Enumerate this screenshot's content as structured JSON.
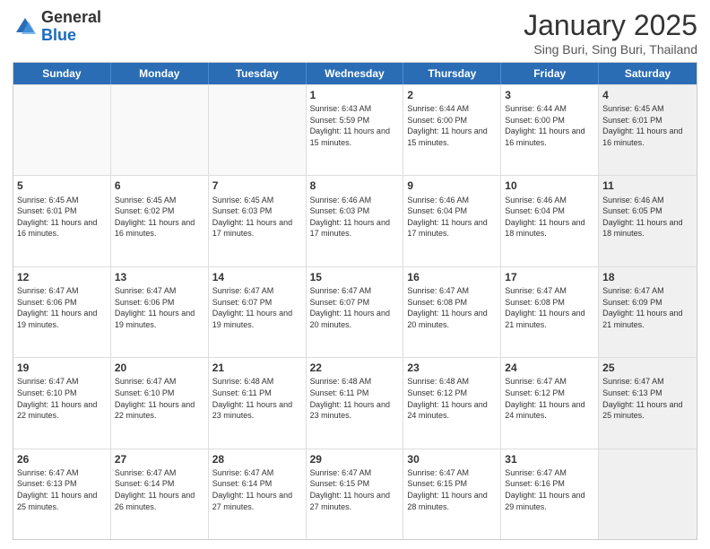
{
  "logo": {
    "general": "General",
    "blue": "Blue"
  },
  "header": {
    "title": "January 2025",
    "subtitle": "Sing Buri, Sing Buri, Thailand"
  },
  "days": [
    "Sunday",
    "Monday",
    "Tuesday",
    "Wednesday",
    "Thursday",
    "Friday",
    "Saturday"
  ],
  "rows": [
    [
      {
        "day": "",
        "empty": true
      },
      {
        "day": "",
        "empty": true
      },
      {
        "day": "",
        "empty": true
      },
      {
        "day": "1",
        "sunrise": "Sunrise: 6:43 AM",
        "sunset": "Sunset: 5:59 PM",
        "daylight": "Daylight: 11 hours and 15 minutes."
      },
      {
        "day": "2",
        "sunrise": "Sunrise: 6:44 AM",
        "sunset": "Sunset: 6:00 PM",
        "daylight": "Daylight: 11 hours and 15 minutes."
      },
      {
        "day": "3",
        "sunrise": "Sunrise: 6:44 AM",
        "sunset": "Sunset: 6:00 PM",
        "daylight": "Daylight: 11 hours and 16 minutes."
      },
      {
        "day": "4",
        "sunrise": "Sunrise: 6:45 AM",
        "sunset": "Sunset: 6:01 PM",
        "daylight": "Daylight: 11 hours and 16 minutes.",
        "shaded": true
      }
    ],
    [
      {
        "day": "5",
        "sunrise": "Sunrise: 6:45 AM",
        "sunset": "Sunset: 6:01 PM",
        "daylight": "Daylight: 11 hours and 16 minutes."
      },
      {
        "day": "6",
        "sunrise": "Sunrise: 6:45 AM",
        "sunset": "Sunset: 6:02 PM",
        "daylight": "Daylight: 11 hours and 16 minutes."
      },
      {
        "day": "7",
        "sunrise": "Sunrise: 6:45 AM",
        "sunset": "Sunset: 6:03 PM",
        "daylight": "Daylight: 11 hours and 17 minutes."
      },
      {
        "day": "8",
        "sunrise": "Sunrise: 6:46 AM",
        "sunset": "Sunset: 6:03 PM",
        "daylight": "Daylight: 11 hours and 17 minutes."
      },
      {
        "day": "9",
        "sunrise": "Sunrise: 6:46 AM",
        "sunset": "Sunset: 6:04 PM",
        "daylight": "Daylight: 11 hours and 17 minutes."
      },
      {
        "day": "10",
        "sunrise": "Sunrise: 6:46 AM",
        "sunset": "Sunset: 6:04 PM",
        "daylight": "Daylight: 11 hours and 18 minutes."
      },
      {
        "day": "11",
        "sunrise": "Sunrise: 6:46 AM",
        "sunset": "Sunset: 6:05 PM",
        "daylight": "Daylight: 11 hours and 18 minutes.",
        "shaded": true
      }
    ],
    [
      {
        "day": "12",
        "sunrise": "Sunrise: 6:47 AM",
        "sunset": "Sunset: 6:06 PM",
        "daylight": "Daylight: 11 hours and 19 minutes."
      },
      {
        "day": "13",
        "sunrise": "Sunrise: 6:47 AM",
        "sunset": "Sunset: 6:06 PM",
        "daylight": "Daylight: 11 hours and 19 minutes."
      },
      {
        "day": "14",
        "sunrise": "Sunrise: 6:47 AM",
        "sunset": "Sunset: 6:07 PM",
        "daylight": "Daylight: 11 hours and 19 minutes."
      },
      {
        "day": "15",
        "sunrise": "Sunrise: 6:47 AM",
        "sunset": "Sunset: 6:07 PM",
        "daylight": "Daylight: 11 hours and 20 minutes."
      },
      {
        "day": "16",
        "sunrise": "Sunrise: 6:47 AM",
        "sunset": "Sunset: 6:08 PM",
        "daylight": "Daylight: 11 hours and 20 minutes."
      },
      {
        "day": "17",
        "sunrise": "Sunrise: 6:47 AM",
        "sunset": "Sunset: 6:08 PM",
        "daylight": "Daylight: 11 hours and 21 minutes."
      },
      {
        "day": "18",
        "sunrise": "Sunrise: 6:47 AM",
        "sunset": "Sunset: 6:09 PM",
        "daylight": "Daylight: 11 hours and 21 minutes.",
        "shaded": true
      }
    ],
    [
      {
        "day": "19",
        "sunrise": "Sunrise: 6:47 AM",
        "sunset": "Sunset: 6:10 PM",
        "daylight": "Daylight: 11 hours and 22 minutes."
      },
      {
        "day": "20",
        "sunrise": "Sunrise: 6:47 AM",
        "sunset": "Sunset: 6:10 PM",
        "daylight": "Daylight: 11 hours and 22 minutes."
      },
      {
        "day": "21",
        "sunrise": "Sunrise: 6:48 AM",
        "sunset": "Sunset: 6:11 PM",
        "daylight": "Daylight: 11 hours and 23 minutes."
      },
      {
        "day": "22",
        "sunrise": "Sunrise: 6:48 AM",
        "sunset": "Sunset: 6:11 PM",
        "daylight": "Daylight: 11 hours and 23 minutes."
      },
      {
        "day": "23",
        "sunrise": "Sunrise: 6:48 AM",
        "sunset": "Sunset: 6:12 PM",
        "daylight": "Daylight: 11 hours and 24 minutes."
      },
      {
        "day": "24",
        "sunrise": "Sunrise: 6:47 AM",
        "sunset": "Sunset: 6:12 PM",
        "daylight": "Daylight: 11 hours and 24 minutes."
      },
      {
        "day": "25",
        "sunrise": "Sunrise: 6:47 AM",
        "sunset": "Sunset: 6:13 PM",
        "daylight": "Daylight: 11 hours and 25 minutes.",
        "shaded": true
      }
    ],
    [
      {
        "day": "26",
        "sunrise": "Sunrise: 6:47 AM",
        "sunset": "Sunset: 6:13 PM",
        "daylight": "Daylight: 11 hours and 25 minutes."
      },
      {
        "day": "27",
        "sunrise": "Sunrise: 6:47 AM",
        "sunset": "Sunset: 6:14 PM",
        "daylight": "Daylight: 11 hours and 26 minutes."
      },
      {
        "day": "28",
        "sunrise": "Sunrise: 6:47 AM",
        "sunset": "Sunset: 6:14 PM",
        "daylight": "Daylight: 11 hours and 27 minutes."
      },
      {
        "day": "29",
        "sunrise": "Sunrise: 6:47 AM",
        "sunset": "Sunset: 6:15 PM",
        "daylight": "Daylight: 11 hours and 27 minutes."
      },
      {
        "day": "30",
        "sunrise": "Sunrise: 6:47 AM",
        "sunset": "Sunset: 6:15 PM",
        "daylight": "Daylight: 11 hours and 28 minutes."
      },
      {
        "day": "31",
        "sunrise": "Sunrise: 6:47 AM",
        "sunset": "Sunset: 6:16 PM",
        "daylight": "Daylight: 11 hours and 29 minutes."
      },
      {
        "day": "",
        "empty": true,
        "shaded": true
      }
    ]
  ]
}
